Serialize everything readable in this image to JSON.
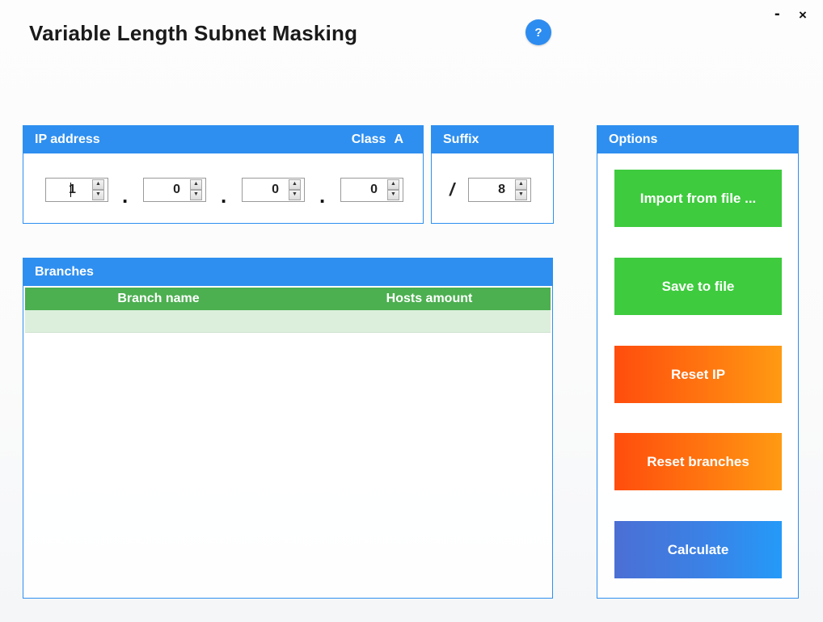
{
  "window": {
    "title": "Variable Length Subnet Masking",
    "help_label": "?",
    "minimize_label": "-",
    "close_label": "×"
  },
  "ip_panel": {
    "title": "IP address",
    "class_label": "Class",
    "class_value": "A",
    "octets": [
      "1",
      "0",
      "0",
      "0"
    ],
    "separator": "."
  },
  "suffix_panel": {
    "title": "Suffix",
    "slash": "/",
    "value": "8"
  },
  "branches_panel": {
    "title": "Branches",
    "columns": [
      "Branch name",
      "Hosts amount"
    ]
  },
  "options_panel": {
    "title": "Options",
    "buttons": {
      "import": "Import from file ...",
      "save": "Save to file",
      "reset_ip": "Reset IP",
      "reset_branches": "Reset branches",
      "calculate": "Calculate"
    }
  },
  "colors": {
    "header_blue": "#2e8ff0",
    "table_header_green": "#4caf50",
    "button_green": "#3ecb3e",
    "button_orange": "#ff6a10",
    "button_blue": "#2f8cf0"
  }
}
